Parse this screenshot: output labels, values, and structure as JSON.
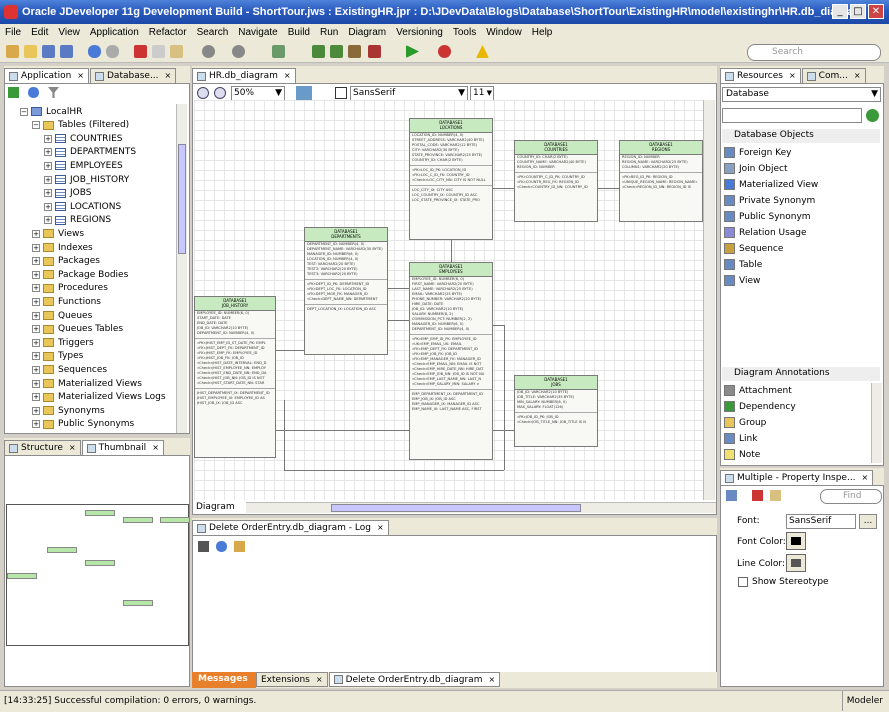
{
  "window": {
    "title": "Oracle JDeveloper 11g Development Build - ShortTour.jws : ExistingHR.jpr : D:\\JDevData\\Blogs\\Database\\ShortTour\\ExistingHR\\model\\existinghr\\HR.db_diagram",
    "minimize": "_",
    "maximize": "□",
    "close": "✕"
  },
  "menu": [
    "File",
    "Edit",
    "View",
    "Application",
    "Refactor",
    "Search",
    "Navigate",
    "Build",
    "Run",
    "Diagram",
    "Versioning",
    "Tools",
    "Window",
    "Help"
  ],
  "toolbar": {
    "search_placeholder": "Search"
  },
  "left_tabs": [
    "Application",
    "Database..."
  ],
  "tree": [
    {
      "label": "LocalHR",
      "level": 0,
      "kind": "conn",
      "expanded": true
    },
    {
      "label": "Tables (Filtered)",
      "level": 1,
      "kind": "folder",
      "expanded": true
    },
    {
      "label": "COUNTRIES",
      "level": 2,
      "kind": "table"
    },
    {
      "label": "DEPARTMENTS",
      "level": 2,
      "kind": "table"
    },
    {
      "label": "EMPLOYEES",
      "level": 2,
      "kind": "table"
    },
    {
      "label": "JOB_HISTORY",
      "level": 2,
      "kind": "table"
    },
    {
      "label": "JOBS",
      "level": 2,
      "kind": "table"
    },
    {
      "label": "LOCATIONS",
      "level": 2,
      "kind": "table"
    },
    {
      "label": "REGIONS",
      "level": 2,
      "kind": "table"
    },
    {
      "label": "Views",
      "level": 1,
      "kind": "folder"
    },
    {
      "label": "Indexes",
      "level": 1,
      "kind": "folder"
    },
    {
      "label": "Packages",
      "level": 1,
      "kind": "folder"
    },
    {
      "label": "Package Bodies",
      "level": 1,
      "kind": "folder"
    },
    {
      "label": "Procedures",
      "level": 1,
      "kind": "folder"
    },
    {
      "label": "Functions",
      "level": 1,
      "kind": "folder"
    },
    {
      "label": "Queues",
      "level": 1,
      "kind": "folder"
    },
    {
      "label": "Queues Tables",
      "level": 1,
      "kind": "folder"
    },
    {
      "label": "Triggers",
      "level": 1,
      "kind": "folder"
    },
    {
      "label": "Types",
      "level": 1,
      "kind": "folder"
    },
    {
      "label": "Sequences",
      "level": 1,
      "kind": "folder"
    },
    {
      "label": "Materialized Views",
      "level": 1,
      "kind": "folder"
    },
    {
      "label": "Materialized Views Logs",
      "level": 1,
      "kind": "folder"
    },
    {
      "label": "Synonyms",
      "level": 1,
      "kind": "folder"
    },
    {
      "label": "Public Synonyms",
      "level": 1,
      "kind": "folder"
    }
  ],
  "structure_tabs": [
    "Structure",
    "Thumbnail"
  ],
  "editor": {
    "tab": "HR.db_diagram",
    "zoom": "50%",
    "font": "SansSerif",
    "font_size": "11",
    "bottom_tab": "Diagram"
  },
  "entities": [
    {
      "id": "locations",
      "schema": "DATABASE1",
      "name": "LOCATIONS",
      "cols": [
        "LOCATION_ID: NUMBER(4, 0)",
        "STREET_ADDRESS: VARCHAR2(40 BYTE)",
        "POSTAL_CODE: VARCHAR2(12 BYTE)",
        "CITY: VARCHAR2(30 BYTE)",
        "STATE_PROVINCE: VARCHAR2(25 BYTE)",
        "COUNTRY_ID: CHAR(2 BYTE)"
      ],
      "keys": [
        "«PK»LOC_ID_PK: LOCATION_ID",
        "«FK»LOC_C_ID_FK: COUNTRY_ID",
        "«Check»LOC_CITY_NN: CITY IS NOT NULL"
      ],
      "idx": [
        "LOC_CITY_IX: CITY ASC",
        "LOC_COUNTRY_IX: COUNTRY_ID ASC",
        "LOC_STATE_PROVINCE_IX: STATE_PRO"
      ]
    },
    {
      "id": "countries",
      "schema": "DATABASE1",
      "name": "COUNTRIES",
      "cols": [
        "COUNTRY_ID: CHAR(2 BYTE)",
        "COUNTRY_NAME: VARCHAR2(40 BYTE)",
        "REGION_ID: NUMBER"
      ],
      "keys": [
        "«PK»COUNTRY_C_ID_PK: COUNTRY_ID",
        "«FK»COUNTR_REG_FK: REGION_ID",
        "«Check»COUNTRY_ID_NN: COUNTRY_ID"
      ],
      "idx": []
    },
    {
      "id": "regions",
      "schema": "DATABASE1",
      "name": "REGIONS",
      "cols": [
        "REGION_ID: NUMBER",
        "REGION_NAME: VARCHAR2(25 BYTE)",
        "COLUMN1: VARCHAR2(20 BYTE)"
      ],
      "keys": [
        "«PK»REG_ID_PK: REGION_ID",
        "«UNIQUE_REGION_NAME: REGION_NAME»",
        "«Check»REGION_ID_NN: REGION_ID IS"
      ],
      "idx": []
    },
    {
      "id": "departments",
      "schema": "DATABASE1",
      "name": "DEPARTMENTS",
      "cols": [
        "DEPARTMENT_ID: NUMBER(4, 0)",
        "DEPARTMENT_NAME: VARCHAR2(30 BYTE)",
        "MANAGER_ID: NUMBER(6, 0)",
        "LOCATION_ID: NUMBER(4, 0)",
        "TEST: VARCHAR2(20 BYTE)",
        "TEST2: VARCHAR2(20 BYTE)",
        "TEST3: VARCHAR2(20 BYTE)"
      ],
      "keys": [
        "«PK»DEPT_ID_PK: DEPARTMENT_ID",
        "«FK»DEPT_LOC_FK: LOCATION_ID",
        "«FK»DEPT_MGR_FK: MANAGER_ID",
        "«Check»DEPT_NAME_NN: DEPARTMENT"
      ],
      "idx": [
        "DEPT_LOCATION_IX: LOCATION_ID ASC"
      ]
    },
    {
      "id": "employees",
      "schema": "DATABASE1",
      "name": "EMPLOYEES",
      "cols": [
        "EMPLOYEE_ID: NUMBER(6, 0)",
        "FIRST_NAME: VARCHAR2(20 BYTE)",
        "LAST_NAME: VARCHAR2(25 BYTE)",
        "EMAIL: VARCHAR2(25 BYTE)",
        "PHONE_NUMBER: VARCHAR2(20 BYTE)",
        "HIRE_DATE: DATE",
        "JOB_ID: VARCHAR2(10 BYTE)",
        "SALARY: NUMBER(8, 2)",
        "COMMISSION_PCT: NUMBER(2, 2)",
        "MANAGER_ID: NUMBER(6, 0)",
        "DEPARTMENT_ID: NUMBER(4, 0)"
      ],
      "keys": [
        "«PK»EMP_EMP_ID_PK: EMPLOYEE_ID",
        "«UK»EMP_EMAIL_UK: EMAIL",
        "«FK»EMP_DEPT_FK: DEPARTMENT_ID",
        "«FK»EMP_JOB_FK: JOB_ID",
        "«FK»EMP_MANAGER_FK: MANAGER_ID",
        "«Check»EMP_EMAIL_NN: EMAIL IS NOT",
        "«Check»EMP_HIRE_DATE_NN: HIRE_DAT",
        "«Check»EMP_JOB_NN: JOB_ID IS NOT NU",
        "«Check»EMP_LAST_NAME_NN: LAST_N",
        "«Check»EMP_SALARY_MIN: SALARY >"
      ],
      "idx": [
        "EMP_DEPARTMENT_IX: DEPARTMENT_ID",
        "EMP_JOB_IX: JOB_ID ASC",
        "EMP_MANAGER_IX: MANAGER_ID ASC",
        "EMP_NAME_IX: LAST_NAME ASC, FIRST"
      ]
    },
    {
      "id": "job_history",
      "schema": "DATABASE1",
      "name": "JOB_HISTORY",
      "cols": [
        "EMPLOYEE_ID: NUMBER(6, 0)",
        "START_DATE: DATE",
        "END_DATE: DATE",
        "JOB_ID: VARCHAR2(10 BYTE)",
        "DEPARTMENT_ID: NUMBER(4, 0)"
      ],
      "keys": [
        "«PK»JHIST_EMP_ID_ST_DATE_PK: EMPL",
        "«FK»JHIST_DEPT_FK: DEPARTMENT_ID",
        "«FK»JHIST_EMP_FK: EMPLOYEE_ID",
        "«FK»JHIST_JOB_FK: JOB_ID",
        "«Check»JHIST_DATE_INTERVAL: END_D",
        "«Check»JHIST_EMPLOYEE_NN: EMPLOY",
        "«Check»JHIST_END_DATE_NN: END_DA",
        "«Check»JHIST_JOB_NN: JOB_ID IS NOT",
        "«Check»JHIST_START_DATE_NN: STAR"
      ],
      "idx": [
        "JHIST_DEPARTMENT_IX: DEPARTMENT_ID",
        "JHIST_EMPLOYEE_IX: EMPLOYEE_ID AS",
        "JHIST_JOB_IX: JOB_ID ASC"
      ]
    },
    {
      "id": "jobs",
      "schema": "DATABASE1",
      "name": "JOBS",
      "cols": [
        "JOB_ID: VARCHAR2(10 BYTE)",
        "JOB_TITLE: VARCHAR2(35 BYTE)",
        "MIN_SALARY: NUMBER(6, 0)",
        "MAX_SALARY: FLOAT(126)"
      ],
      "keys": [
        "«PK»JOB_ID_PK: JOB_ID",
        "«Check»JOB_TITLE_NN: JOB_TITLE IS N"
      ],
      "idx": []
    }
  ],
  "log": {
    "tab": "Delete OrderEntry.db_diagram - Log"
  },
  "log_bottom_tabs": [
    "Messages",
    "Extensions",
    "Delete OrderEntry.db_diagram"
  ],
  "right_tabs": [
    "Resources",
    "Com..."
  ],
  "palette": {
    "category": "Database",
    "section1": "Database Objects",
    "objects": [
      "Foreign Key",
      "Join Object",
      "Materialized View",
      "Private Synonym",
      "Public Synonym",
      "Relation Usage",
      "Sequence",
      "Table",
      "View"
    ],
    "section2": "Diagram Annotations",
    "annotations": [
      "Attachment",
      "Dependency",
      "Group",
      "Link",
      "Note"
    ]
  },
  "inspector": {
    "tab": "Multiple - Property Inspe...",
    "find_placeholder": "Find",
    "font_label": "Font:",
    "font_value": "SansSerif",
    "font_color_label": "Font Color:",
    "line_color_label": "Line Color:",
    "show_stereotype": "Show Stereotype"
  },
  "status": {
    "message": "[14:33:25] Successful compilation: 0 errors, 0 warnings.",
    "mode": "Modeler"
  }
}
